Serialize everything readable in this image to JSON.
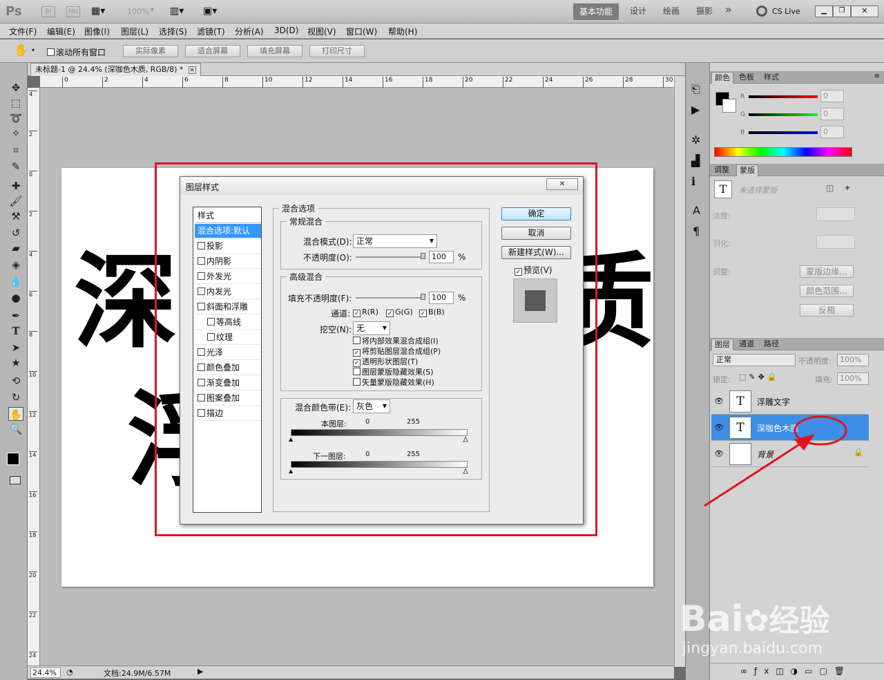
{
  "app": {
    "logo": "Ps",
    "br": "Br",
    "mb": "Mb",
    "zoom_preset": "100%",
    "workspaces": [
      "基本功能",
      "设计",
      "绘画",
      "摄影"
    ],
    "more": "»",
    "cslive": "CS Live"
  },
  "menu": [
    "文件(F)",
    "编辑(E)",
    "图像(I)",
    "图层(L)",
    "选择(S)",
    "滤镜(T)",
    "分析(A)",
    "3D(D)",
    "视图(V)",
    "窗口(W)",
    "帮助(H)"
  ],
  "options": {
    "scroll_all": "滚动所有窗口",
    "actual_pixels": "实际像素",
    "fit_screen": "适合屏幕",
    "fill_screen": "填充屏幕",
    "print_size": "打印尺寸"
  },
  "document": {
    "tab_title": "未标题-1 @ 24.4% (深咖色木质, RGB/8) *",
    "text_line1": "深",
    "text_line1_end": "质",
    "text_line2": "浮",
    "zoom": "24.4%",
    "doc_info": "文档:24.9M/6.57M"
  },
  "ruler": {
    "h_ticks": [
      "0",
      "2",
      "4",
      "6",
      "8",
      "10",
      "12",
      "14",
      "16",
      "18",
      "20",
      "22",
      "24",
      "26",
      "28",
      "30"
    ],
    "v_ticks": [
      "4",
      "2",
      "0",
      "2",
      "4",
      "6",
      "8",
      "10",
      "12",
      "14",
      "16",
      "18",
      "20",
      "22",
      "24"
    ]
  },
  "color_panel": {
    "tabs": [
      "颜色",
      "色板",
      "样式"
    ],
    "channels": [
      {
        "label": "R",
        "value": "0"
      },
      {
        "label": "G",
        "value": "0"
      },
      {
        "label": "B",
        "value": "0"
      }
    ]
  },
  "adjust_panel": {
    "tabs": [
      "调整",
      "蒙版"
    ],
    "no_mask": "未选择蒙版",
    "density": "浓度:",
    "feather": "羽化:",
    "refine": "调整:",
    "mask_edge": "蒙版边缘...",
    "color_range": "颜色范围...",
    "invert": "反相"
  },
  "layers_panel": {
    "tabs": [
      "图层",
      "通道",
      "路径"
    ],
    "blend_mode": "正常",
    "opacity_label": "不透明度:",
    "opacity": "100%",
    "lock_label": "锁定:",
    "fill_label": "填充:",
    "fill": "100%",
    "layers": [
      {
        "name": "浮雕文字",
        "type": "T"
      },
      {
        "name": "深咖色木质",
        "type": "T"
      },
      {
        "name": "背景",
        "type": ""
      }
    ]
  },
  "dialog": {
    "title": "图层样式",
    "styles_header": "样式",
    "styles": [
      {
        "label": "混合选项:默认",
        "checkbox": false,
        "selected": true
      },
      {
        "label": "投影",
        "checkbox": true
      },
      {
        "label": "内阴影",
        "checkbox": true
      },
      {
        "label": "外发光",
        "checkbox": true
      },
      {
        "label": "内发光",
        "checkbox": true
      },
      {
        "label": "斜面和浮雕",
        "checkbox": true
      },
      {
        "label": "等高线",
        "checkbox": true,
        "indent": true
      },
      {
        "label": "纹理",
        "checkbox": true,
        "indent": true
      },
      {
        "label": "光泽",
        "checkbox": true
      },
      {
        "label": "颜色叠加",
        "checkbox": true
      },
      {
        "label": "渐变叠加",
        "checkbox": true
      },
      {
        "label": "图案叠加",
        "checkbox": true
      },
      {
        "label": "描边",
        "checkbox": true
      }
    ],
    "blend_options": "混合选项",
    "general_blend": "常规混合",
    "blend_mode_label": "混合模式(D):",
    "blend_mode": "正常",
    "opacity_label": "不透明度(O):",
    "opacity": "100",
    "percent": "%",
    "advanced_blend": "高级混合",
    "fill_opacity_label": "填充不透明度(F):",
    "fill_opacity": "100",
    "channels_label": "通道:",
    "ch_r": "R(R)",
    "ch_g": "G(G)",
    "ch_b": "B(B)",
    "knockout_label": "挖空(N):",
    "knockout": "无",
    "options": [
      {
        "label": "将内部效果混合成组(I)",
        "checked": false
      },
      {
        "label": "将剪贴图层混合成组(P)",
        "checked": true
      },
      {
        "label": "透明形状图层(T)",
        "checked": true
      },
      {
        "label": "图层蒙版隐藏效果(S)",
        "checked": false
      },
      {
        "label": "矢量蒙版隐藏效果(H)",
        "checked": false
      }
    ],
    "blend_if_label": "混合颜色带(E):",
    "blend_if": "灰色",
    "this_layer": "本图层:",
    "under_layer": "下一图层:",
    "min": "0",
    "max": "255",
    "ok": "确定",
    "cancel": "取消",
    "new_style": "新建样式(W)...",
    "preview": "预览(V)"
  },
  "watermark": {
    "brand": "Bai",
    "brand2": "经验",
    "url": "jingyan.baidu.com"
  }
}
